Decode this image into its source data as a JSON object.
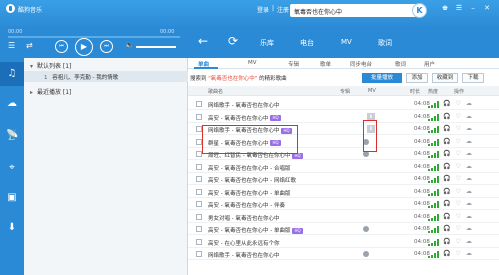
{
  "window": {
    "app_title": "酷狗音乐",
    "login": "登录",
    "register": "注册",
    "search_value": "氧毒否也在你心中"
  },
  "player": {
    "time_current": "00:00",
    "time_total": "00:00"
  },
  "nav": {
    "tabs": [
      "乐库",
      "电台",
      "MV",
      "歌词"
    ]
  },
  "playlist": {
    "default_list": {
      "label": "默认列表",
      "count": "[1]"
    },
    "items": [
      {
        "num": "1",
        "label": "容祖儿、李克勤 - 我的情歌"
      }
    ],
    "recent": {
      "label": "最近播放",
      "count": "[1]"
    }
  },
  "main": {
    "subtabs": [
      "单曲",
      "MV",
      "专辑",
      "歌单",
      "同步电台",
      "歌词",
      "用户"
    ],
    "result_prefix": "搜索到",
    "result_query": "\"氧毒否也在你心中\"",
    "result_suffix": "的精彩歌曲",
    "btn_play_all": "批量播放",
    "btn_add": "添加",
    "btn_favorite": "收藏到",
    "btn_download": "下载",
    "col_title": "歌曲名",
    "col_album": "专辑",
    "col_mv": "MV",
    "col_duration": "时长",
    "col_quality": "热度",
    "col_ops": "操作",
    "rows": [
      {
        "title": "网络歌手 - 氧毒否也在你心中",
        "badge": "",
        "duration": "04:08"
      },
      {
        "title": "高安 - 氧毒否也在你心中",
        "badge": "HQ",
        "duration": "04:08"
      },
      {
        "title": "网络歌手 - 氧毒否也在你心中",
        "badge": "HQ",
        "duration": "04:08"
      },
      {
        "title": "群星 - 氧毒否也在你心中",
        "badge": "HQ",
        "duration": "04:08"
      },
      {
        "title": "周旺、红智民 - 氧毒否也在你心中",
        "badge": "HQ",
        "duration": "04:08"
      },
      {
        "title": "高安 - 氧毒否也在你心中 - 合唱版",
        "badge": "",
        "duration": "04:08"
      },
      {
        "title": "高安 - 氧毒否也在你心中 - 网络红歌",
        "badge": "",
        "duration": "04:08"
      },
      {
        "title": "高安 - 氧毒否也在你心中 - 单曲版",
        "badge": "",
        "duration": "04:08"
      },
      {
        "title": "高安 - 氧毒否也在你心中 - 伴奏",
        "badge": "",
        "duration": "04:08"
      },
      {
        "title": "男女对唱 - 氧毒否也在你心中",
        "badge": "",
        "duration": "04:08"
      },
      {
        "title": "高安 - 氧毒否也在你心中 - 单曲版",
        "badge": "HQ",
        "duration": "04:08"
      },
      {
        "title": "高安 - 在心里从此永远有个你",
        "badge": "",
        "duration": "04:08"
      },
      {
        "title": "网络歌手 - 氧毒否也在你心中",
        "badge": "",
        "duration": "04:08"
      }
    ]
  },
  "colors": {
    "brand": "#2b8ad6",
    "highlight": "#d9302c",
    "quality": "#2fa836"
  }
}
